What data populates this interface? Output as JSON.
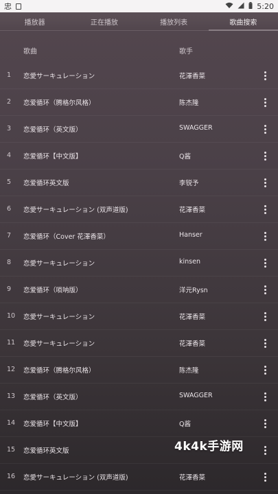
{
  "status": {
    "left_icon_text": "忠",
    "time": "5:20",
    "icons": [
      "wifi-icon",
      "signal-icon",
      "battery-icon"
    ]
  },
  "tabs": [
    {
      "label": "播放器",
      "active": false
    },
    {
      "label": "正在播放",
      "active": false
    },
    {
      "label": "播放列表",
      "active": false
    },
    {
      "label": "歌曲搜索",
      "active": true
    }
  ],
  "header": {
    "song": "歌曲",
    "artist": "歌手"
  },
  "songs": [
    {
      "index": "1",
      "title": "恋愛サーキュレーション",
      "artist": "花澤香菜"
    },
    {
      "index": "2",
      "title": "恋爱循环（腾格尔风格）",
      "artist": "陈杰隆"
    },
    {
      "index": "3",
      "title": "恋爱循环（英文版）",
      "artist": "SWAGGER"
    },
    {
      "index": "4",
      "title": "恋爱循环【中文版】",
      "artist": "Q酱"
    },
    {
      "index": "5",
      "title": "恋爱循环英文版",
      "artist": "李锐予"
    },
    {
      "index": "6",
      "title": "恋愛サーキュレーション (双声道版)",
      "artist": "花澤香菜"
    },
    {
      "index": "7",
      "title": "恋爱循环（Cover 花澤香菜）",
      "artist": "Hanser"
    },
    {
      "index": "8",
      "title": "恋愛サーキュレーション",
      "artist": "kinsen"
    },
    {
      "index": "9",
      "title": "恋爱循环（唢呐版）",
      "artist": "洋元Rysn"
    },
    {
      "index": "10",
      "title": "恋愛サーキュレーション",
      "artist": "花澤香菜"
    },
    {
      "index": "11",
      "title": "恋愛サーキュレーション",
      "artist": "花澤香菜"
    },
    {
      "index": "12",
      "title": "恋爱循环（腾格尔风格）",
      "artist": "陈杰隆"
    },
    {
      "index": "13",
      "title": "恋爱循环（英文版）",
      "artist": "SWAGGER"
    },
    {
      "index": "14",
      "title": "恋爱循环【中文版】",
      "artist": "Q酱"
    },
    {
      "index": "15",
      "title": "恋爱循环英文版",
      "artist": ""
    },
    {
      "index": "16",
      "title": "恋愛サーキュレーション (双声道版)",
      "artist": "花澤香菜"
    }
  ],
  "watermark": "4k4k手游网"
}
